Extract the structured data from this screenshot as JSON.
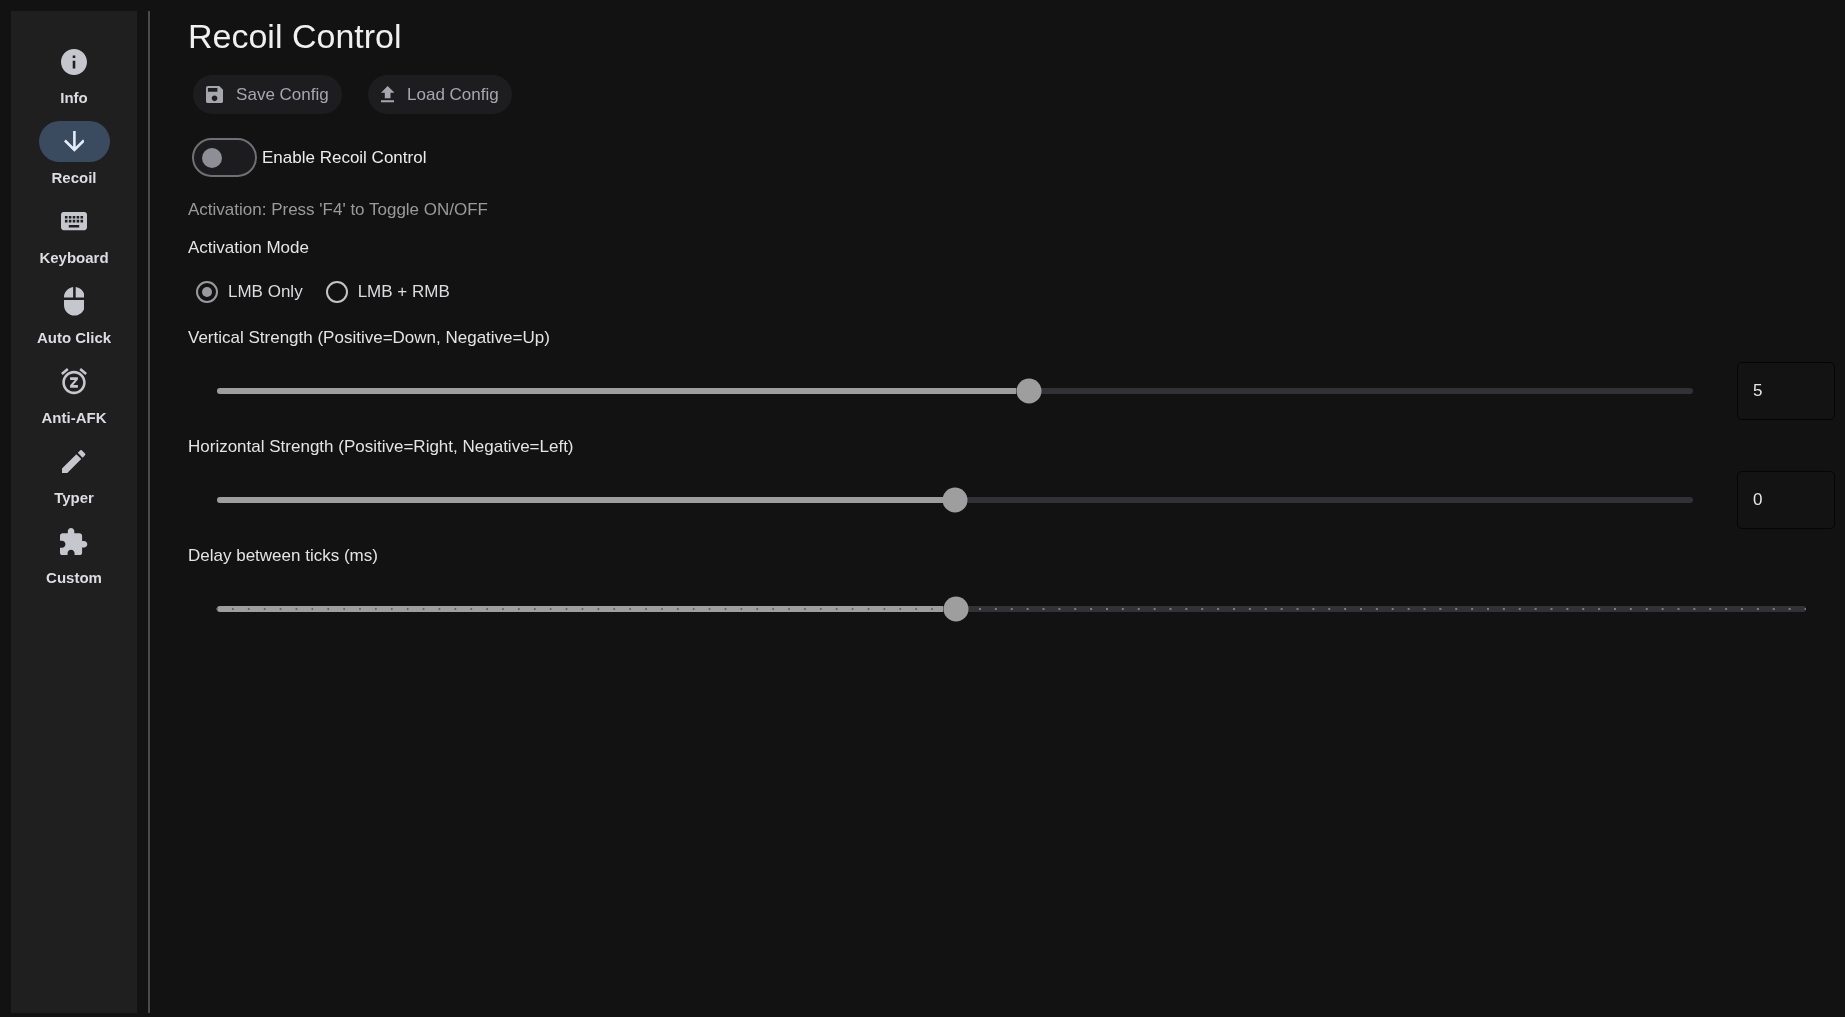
{
  "sidebar": {
    "items": [
      {
        "label": "Info",
        "selected": false
      },
      {
        "label": "Recoil",
        "selected": true
      },
      {
        "label": "Keyboard",
        "selected": false
      },
      {
        "label": "Auto Click",
        "selected": false
      },
      {
        "label": "Anti-AFK",
        "selected": false
      },
      {
        "label": "Typer",
        "selected": false
      },
      {
        "label": "Custom",
        "selected": false
      }
    ]
  },
  "page": {
    "title": "Recoil Control"
  },
  "toolbar": {
    "buttons": [
      {
        "label": "Save Config"
      },
      {
        "label": "Load Config"
      }
    ]
  },
  "enable_toggle": {
    "label": "Enable Recoil Control",
    "on": false
  },
  "activation_hint": "Activation: Press 'F4' to Toggle ON/OFF",
  "activation_mode": {
    "label": "Activation Mode",
    "options": [
      {
        "label": "LMB Only",
        "selected": true
      },
      {
        "label": "LMB + RMB",
        "selected": false
      }
    ]
  },
  "sliders": [
    {
      "kind": "continuous",
      "label": "Vertical Strength (Positive=Down, Negative=Up)",
      "level": 0.55,
      "value": "5"
    },
    {
      "kind": "continuous",
      "label": "Horizontal Strength (Positive=Right, Negative=Left)",
      "level": 0.5,
      "value": "0"
    },
    {
      "kind": "stepped",
      "label": "Delay between ticks (ms)",
      "level": 0.465
    }
  ]
}
